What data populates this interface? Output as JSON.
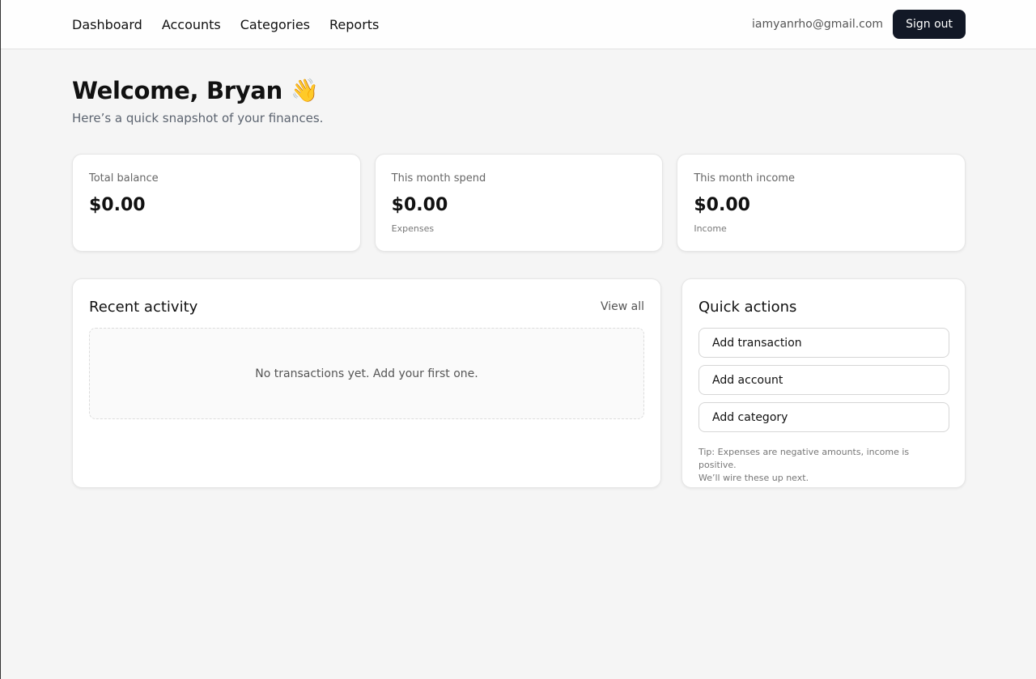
{
  "nav": {
    "items": [
      {
        "label": "Dashboard"
      },
      {
        "label": "Accounts"
      },
      {
        "label": "Categories"
      },
      {
        "label": "Reports"
      }
    ]
  },
  "user": {
    "email": "iamyanrho@gmail.com",
    "sign_out_label": "Sign out"
  },
  "header": {
    "title": "Welcome, Bryan",
    "emoji": "👋",
    "subtitle": "Here’s a quick snapshot of your finances."
  },
  "stats": [
    {
      "label": "Total balance",
      "value": "$0.00",
      "sub": ""
    },
    {
      "label": "This month spend",
      "value": "$0.00",
      "sub": "Expenses"
    },
    {
      "label": "This month income",
      "value": "$0.00",
      "sub": "Income"
    }
  ],
  "activity": {
    "title": "Recent activity",
    "view_all_label": "View all",
    "empty_text": "No transactions yet. Add your first one."
  },
  "quick_actions": {
    "title": "Quick actions",
    "buttons": [
      {
        "label": "Add transaction"
      },
      {
        "label": "Add account"
      },
      {
        "label": "Add category"
      }
    ],
    "tip_line1": "Tip: Expenses are negative amounts, income is positive.",
    "tip_line2": "We’ll wire these up next."
  },
  "colors": {
    "page_background": "#f5f5f5",
    "primary_button": "#121826"
  }
}
